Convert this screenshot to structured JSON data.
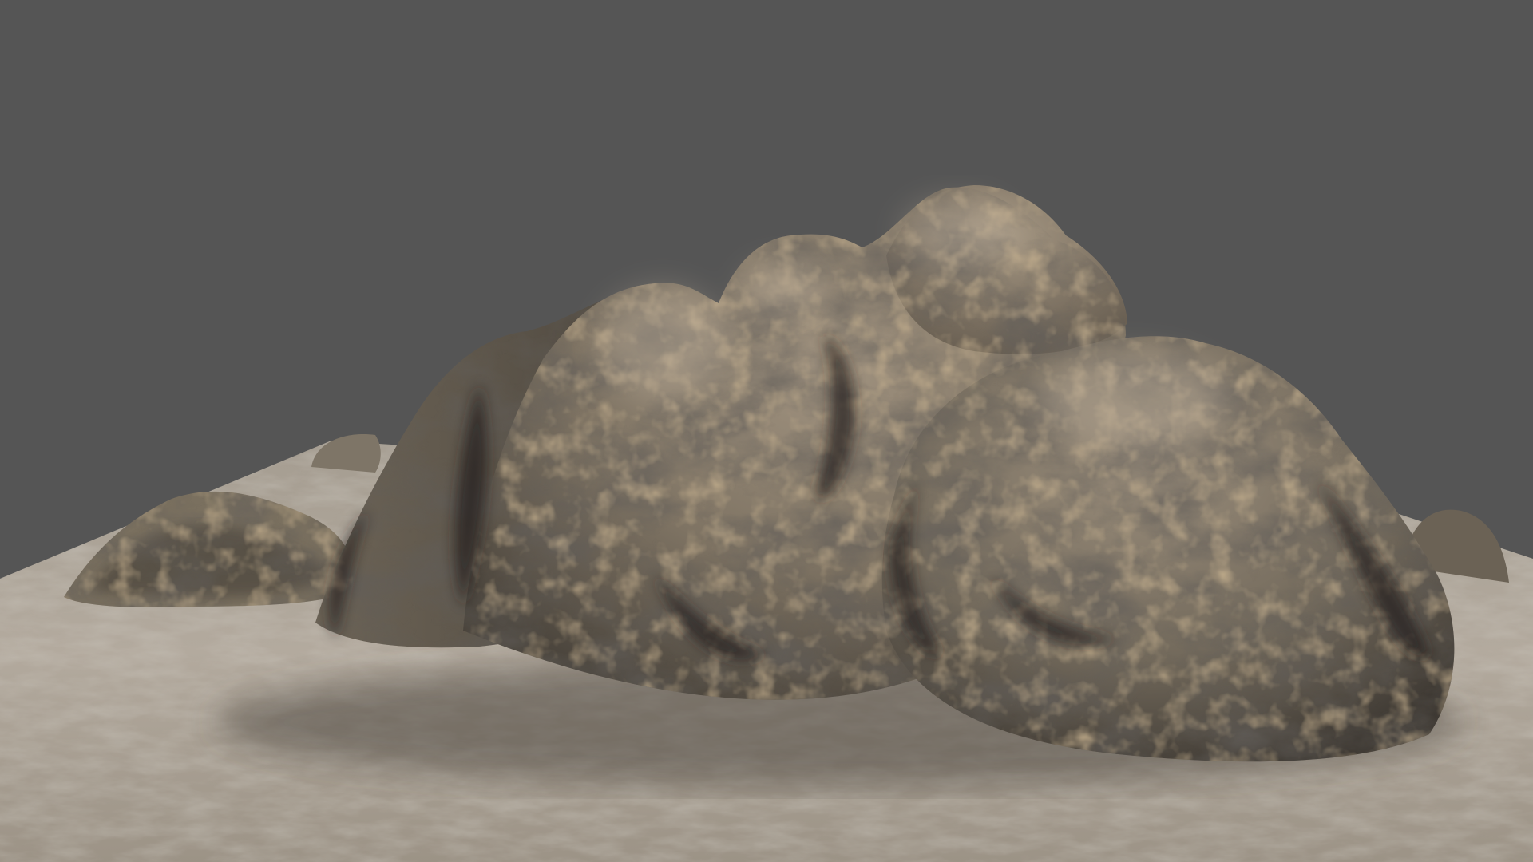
{
  "scene": {
    "subject": "rock-formation-render",
    "colors": {
      "background": "#555555",
      "ground_light": "#b8b0a4",
      "ground_mid": "#9a9184",
      "ground_dark": "#6f675c",
      "rock_light": "#a39580",
      "rock_mid": "#7d7262",
      "rock_dark": "#3d3833",
      "rock_ochre": "#8c7450",
      "rock_shadow": "#26231f"
    }
  }
}
